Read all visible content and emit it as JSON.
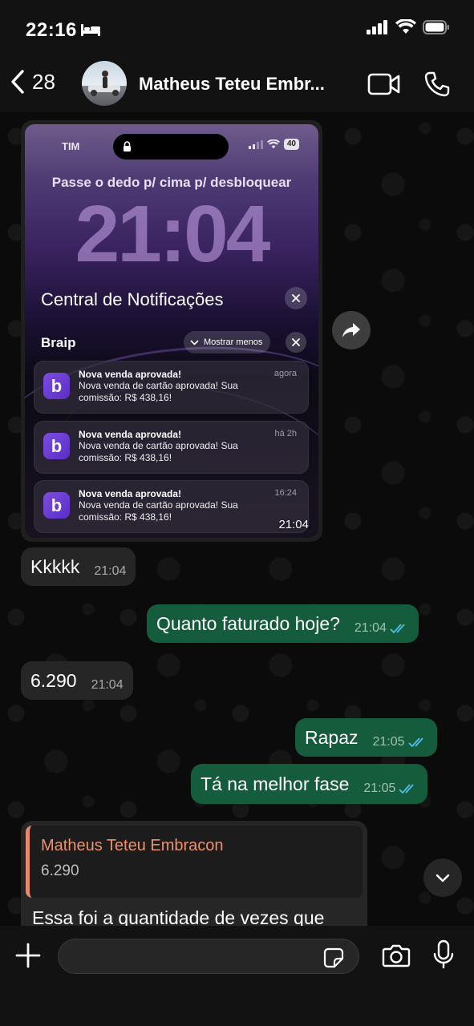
{
  "status_bar": {
    "time": "22:16",
    "battery_icon": "battery-icon",
    "signal_icon": "signal-icon",
    "wifi_icon": "wifi-icon",
    "sleep_icon": "bed-icon"
  },
  "header": {
    "back_count": "28",
    "contact_name": "Matheus Teteu Embr...",
    "video_icon": "video-call-icon",
    "call_icon": "phone-icon"
  },
  "image_message": {
    "time": "21:04",
    "screenshot": {
      "carrier": "TIM",
      "battery": "40",
      "unlock_text": "Passe o dedo p/ cima p/ desbloquear",
      "lock_time": "21:04",
      "notification_center_title": "Central de Notificações",
      "app_name": "Braip",
      "show_less_label": "Mostrar menos",
      "notifications": [
        {
          "title": "Nova venda aprovada!",
          "time": "agora",
          "body": "Nova venda de cartão aprovada! Sua comissão: R$ 438,16!"
        },
        {
          "title": "Nova venda aprovada!",
          "time": "há 2h",
          "body": "Nova venda de cartão aprovada! Sua comissão: R$ 438,16!"
        },
        {
          "title": "Nova venda aprovada!",
          "time": "16:24",
          "body": "Nova venda de cartão aprovada! Sua comissão: R$ 438,16!"
        }
      ]
    }
  },
  "messages": [
    {
      "direction": "in",
      "text": "Kkkkk",
      "time": "21:04"
    },
    {
      "direction": "out",
      "text": "Quanto faturado hoje?",
      "time": "21:04"
    },
    {
      "direction": "in",
      "text": "6.290",
      "time": "21:04"
    },
    {
      "direction": "out",
      "text": "Rapaz",
      "time": "21:05"
    },
    {
      "direction": "out",
      "text": "Tá na melhor fase",
      "time": "21:05"
    }
  ],
  "reply_message": {
    "quoted_name": "Matheus Teteu Embracon",
    "quoted_text": "6.290",
    "text": "Essa foi a quantidade de vezes que"
  },
  "composer": {
    "placeholder": "",
    "value": ""
  },
  "colors": {
    "outgoing_bubble": "#145c3c",
    "incoming_bubble": "#262626",
    "read_ticks": "#53bdeb",
    "quote_accent": "#e98a6b"
  }
}
